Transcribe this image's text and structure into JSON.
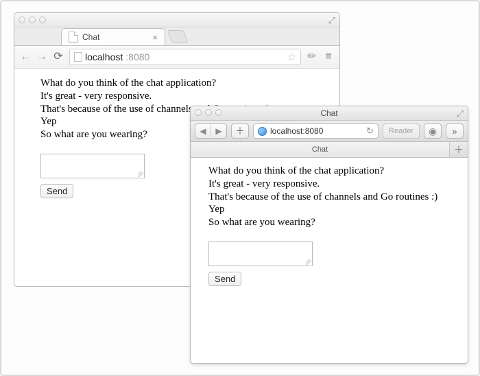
{
  "chrome": {
    "tab_title": "Chat",
    "url_host": "localhost",
    "url_port": ":8080"
  },
  "safari": {
    "window_title": "Chat",
    "tab_title": "Chat",
    "url": "localhost:8080",
    "reader_label": "Reader"
  },
  "chat": {
    "messages": [
      "What do you think of the chat application?",
      "It's great - very responsive.",
      "That's because of the use of channels and Go routines :)",
      "Yep",
      "So what are you wearing?"
    ],
    "send_label": "Send"
  }
}
